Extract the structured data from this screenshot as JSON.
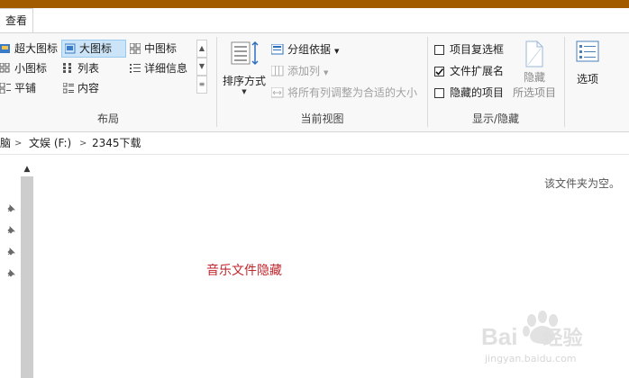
{
  "tabs": {
    "view_label": "查看"
  },
  "ribbon": {
    "layout": {
      "group_label": "布局",
      "items": [
        {
          "label": "超大图标",
          "icon": "extra-large-icons-icon"
        },
        {
          "label": "大图标",
          "icon": "large-icons-icon",
          "selected": true
        },
        {
          "label": "中图标",
          "icon": "medium-icons-icon"
        },
        {
          "label": "小图标",
          "icon": "small-icons-icon"
        },
        {
          "label": "列表",
          "icon": "list-icon"
        },
        {
          "label": "详细信息",
          "icon": "details-icon"
        },
        {
          "label": "平铺",
          "icon": "tiles-icon"
        },
        {
          "label": "内容",
          "icon": "content-icon"
        }
      ]
    },
    "current_view": {
      "group_label": "当前视图",
      "sort_label": "排序方式",
      "group_by_label": "分组依据",
      "add_column_label": "添加列",
      "fit_columns_label": "将所有列调整为合适的大小"
    },
    "show_hide": {
      "group_label": "显示/隐藏",
      "item_checkboxes_label": "项目复选框",
      "item_checkboxes_checked": false,
      "file_extensions_label": "文件扩展名",
      "file_extensions_checked": true,
      "hidden_items_label": "隐藏的项目",
      "hidden_items_checked": false,
      "hide_selected_line1": "隐藏",
      "hide_selected_line2": "所选项目"
    },
    "options": {
      "label": "选项"
    }
  },
  "address": {
    "crumbs": [
      "脑",
      "文娱 (F:)",
      "2345下载"
    ]
  },
  "content": {
    "empty_message": "该文件夹为空。",
    "annotation": "音乐文件隐藏"
  },
  "watermark": {
    "brand": "Bai",
    "brand_suffix": "经验",
    "url": "jingyan.baidu.com"
  },
  "colors": {
    "title_bar": "#a35b00",
    "selection": "#cce4f7",
    "annotation": "#c0272d"
  }
}
